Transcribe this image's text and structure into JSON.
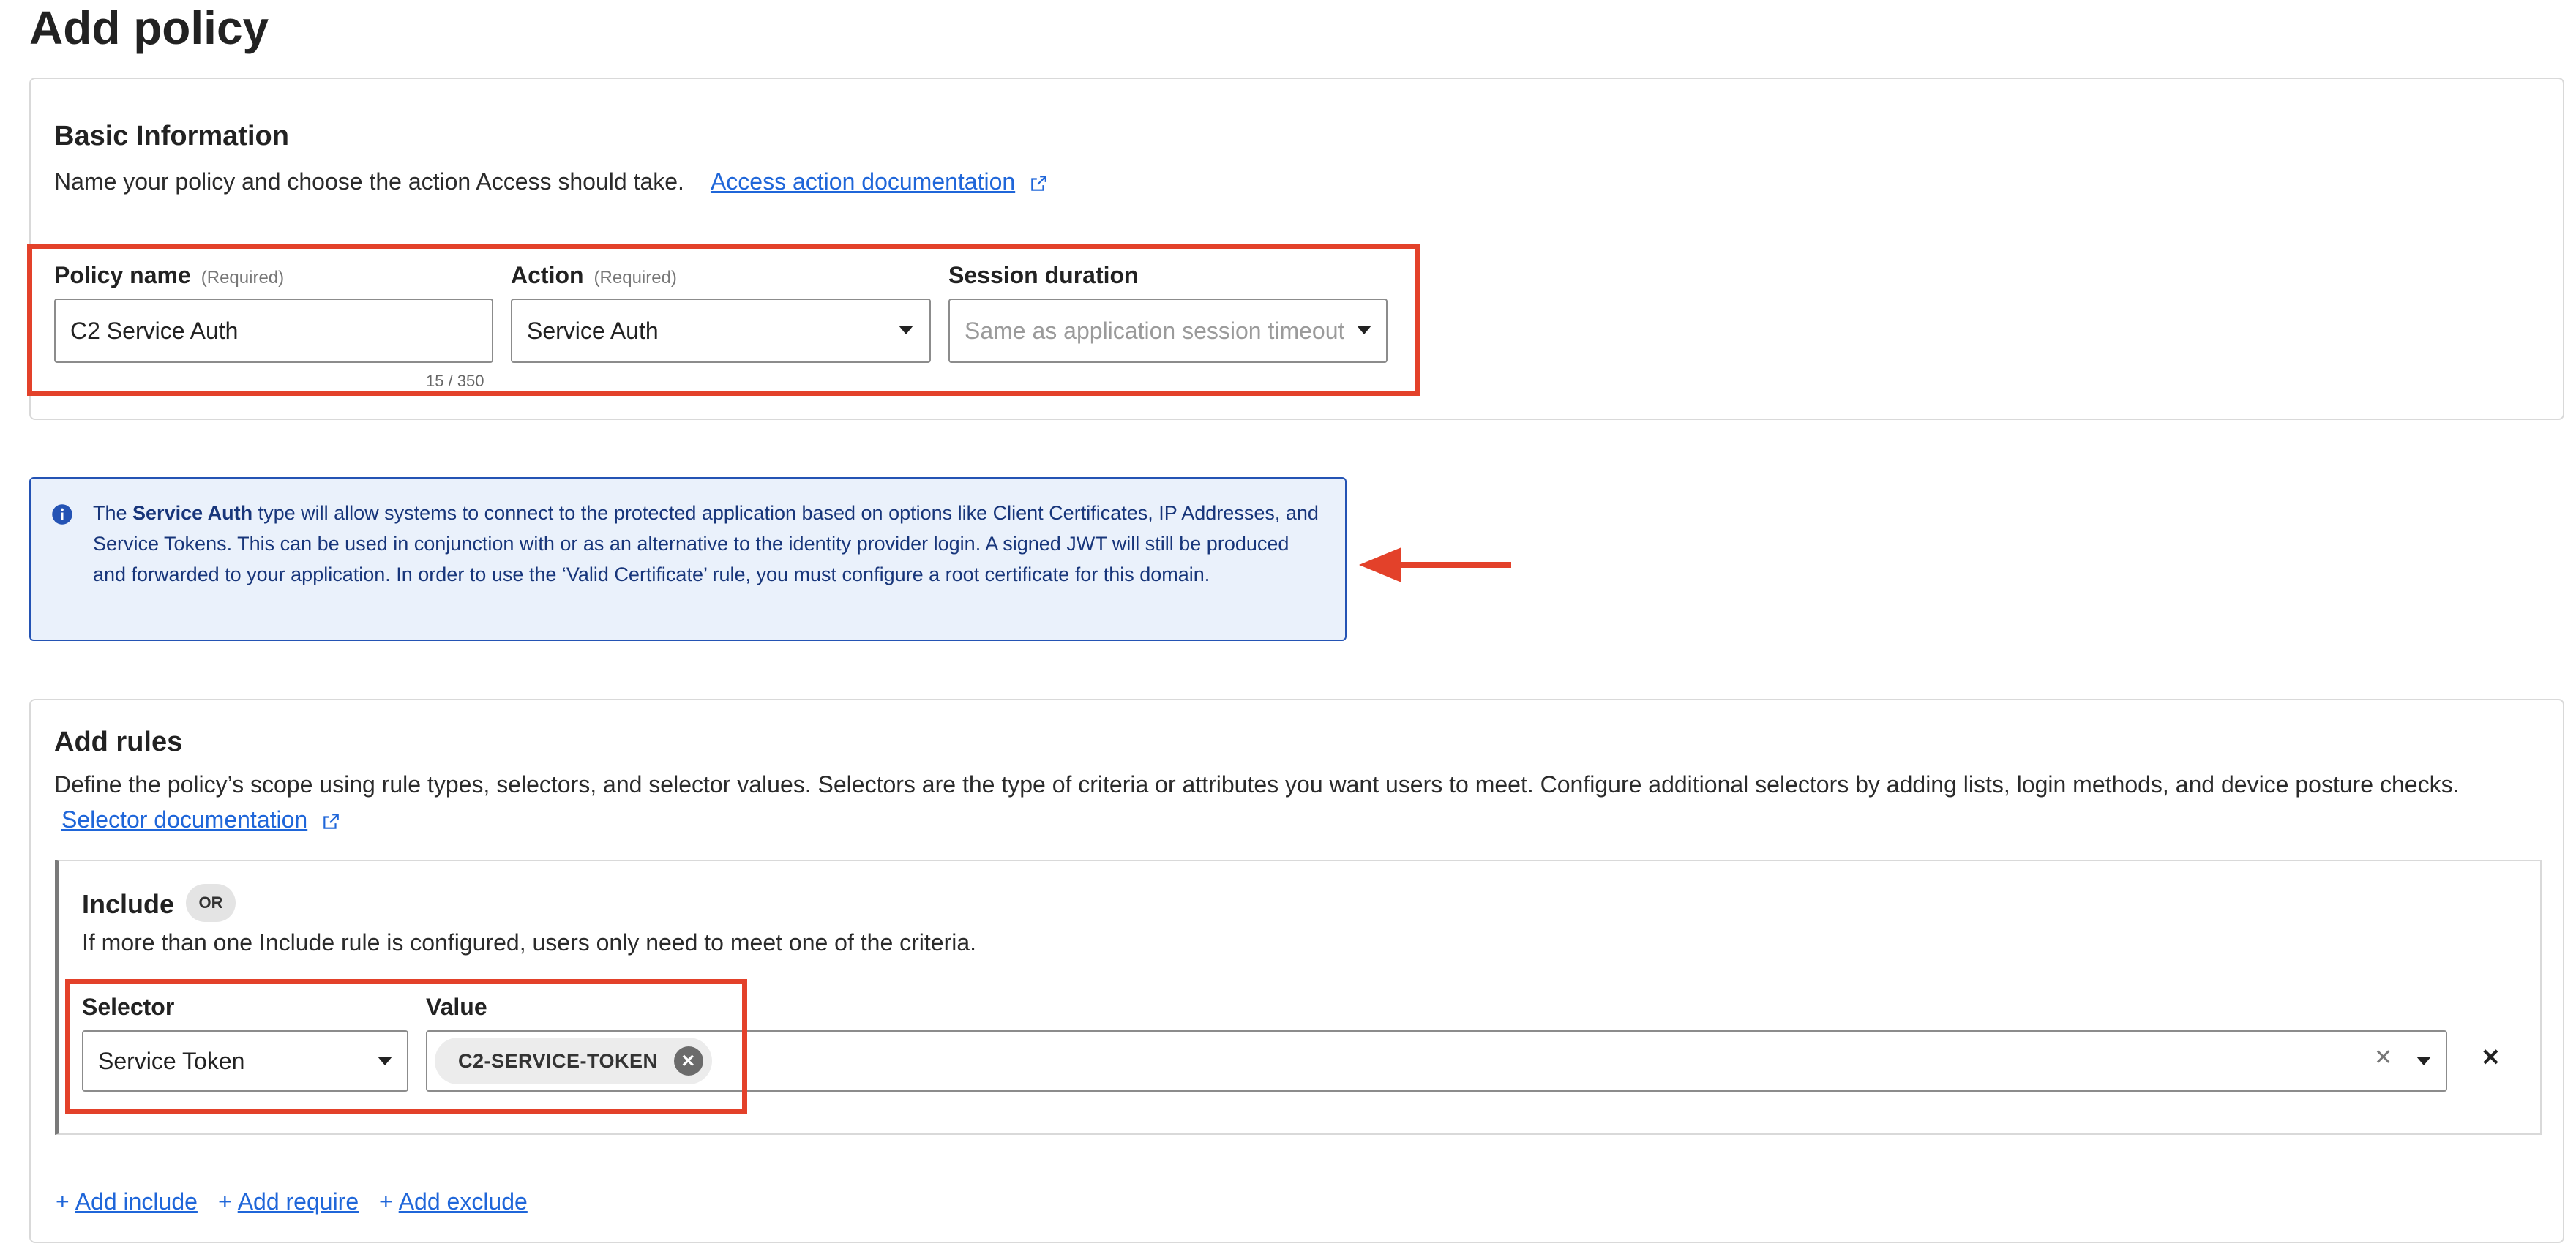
{
  "page": {
    "title": "Add policy"
  },
  "basic_info": {
    "title": "Basic Information",
    "description": "Name your policy and choose the action Access should take.",
    "doc_link": "Access action documentation",
    "policy_name": {
      "label": "Policy name",
      "required": "(Required)",
      "value": "C2 Service Auth",
      "counter": "15 / 350"
    },
    "action": {
      "label": "Action",
      "required": "(Required)",
      "value": "Service Auth"
    },
    "session_duration": {
      "label": "Session duration",
      "placeholder": "Same as application session timeout"
    }
  },
  "info_box": {
    "prefix": "The ",
    "bold": "Service Auth",
    "text": " type will allow systems to connect to the protected application based on options like Client Certificates, IP Addresses, and Service Tokens. This can be used in conjunction with or as an alternative to the identity provider login. A signed JWT will still be produced and forwarded to your application. In order to use the ‘Valid Certificate’ rule, you must configure a root certificate for this domain."
  },
  "rules": {
    "title": "Add rules",
    "description": "Define the policy’s scope using rule types, selectors, and selector values. Selectors are the type of criteria or attributes you want users to meet. Configure additional selectors by adding lists, login methods, and device posture checks.",
    "doc_link": "Selector documentation",
    "include": {
      "title": "Include",
      "badge": "OR",
      "description": "If more than one Include rule is configured, users only need to meet one of the criteria.",
      "selector_label": "Selector",
      "selector_value": "Service Token",
      "value_label": "Value",
      "value_chip": "C2-SERVICE-TOKEN"
    },
    "actions": {
      "add_include": "Add include",
      "add_require": "Add require",
      "add_exclude": "Add exclude"
    }
  },
  "colors": {
    "annotation_red": "#e3412a",
    "link_blue": "#1f66d9",
    "info_border": "#2453b4",
    "info_bg": "#eaf1fb"
  },
  "icons": [
    "external-link-icon",
    "info-icon",
    "chevron-down-icon",
    "clear-icon",
    "remove-icon",
    "arrow-left-icon"
  ]
}
